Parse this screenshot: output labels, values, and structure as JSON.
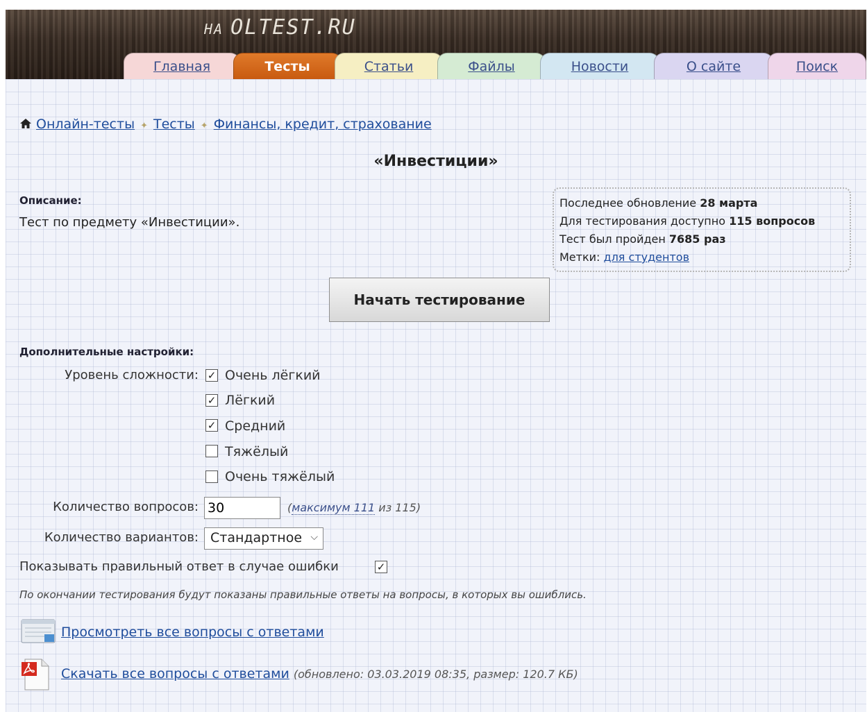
{
  "site": {
    "logo_prefix": "НА",
    "logo_text": "OLTEST.RU"
  },
  "nav": {
    "tabs": [
      {
        "label": "Главная",
        "active": false,
        "color": "#f6d7d7"
      },
      {
        "label": "Тесты",
        "active": true,
        "color": "#d9701e"
      },
      {
        "label": "Статьи",
        "active": false,
        "color": "#f6efc3"
      },
      {
        "label": "Файлы",
        "active": false,
        "color": "#d5ebd3"
      },
      {
        "label": "Новости",
        "active": false,
        "color": "#d3e7f2"
      },
      {
        "label": "О сайте",
        "active": false,
        "color": "#dad6f1"
      },
      {
        "label": "Поиск",
        "active": false,
        "color": "#efd6ea"
      }
    ]
  },
  "breadcrumb": {
    "home_icon": "home-icon",
    "items": [
      "Онлайн-тесты",
      "Тесты",
      "Финансы, кредит, страхование"
    ]
  },
  "test": {
    "title": "«Инвестиции»",
    "description_label": "Описание:",
    "description": "Тест по предмету «Инвестиции»."
  },
  "info": {
    "updated_label": "Последнее обновление",
    "updated_value": "28 марта",
    "available_label": "Для тестирования доступно",
    "available_value": "115 вопросов",
    "passed_label": "Тест был пройден",
    "passed_value": "7685 раз",
    "tags_label": "Метки:",
    "tag": "для студентов"
  },
  "start_button": "Начать тестирование",
  "settings": {
    "label": "Дополнительные настройки:",
    "difficulty_label": "Уровень сложности:",
    "difficulty": [
      {
        "label": "Очень лёгкий",
        "checked": true
      },
      {
        "label": "Лёгкий",
        "checked": true
      },
      {
        "label": "Средний",
        "checked": true
      },
      {
        "label": "Тяжёлый",
        "checked": false
      },
      {
        "label": "Очень тяжёлый",
        "checked": false
      }
    ],
    "questions_label": "Количество вопросов:",
    "questions_value": "30",
    "questions_hint_prefix": "(",
    "questions_hint_max": "максимум 111",
    "questions_hint_suffix": " из 115)",
    "variants_label": "Количество вариантов:",
    "variants_value": "Стандартное",
    "show_answer_label": "Показывать правильный ответ в случае ошибки",
    "show_answer_checked": true,
    "note": "По окончании тестирования будут показаны правильные ответы на вопросы, в которых вы ошиблись."
  },
  "resources": {
    "view_link": "Просмотреть все вопросы с ответами",
    "download_link": "Скачать все вопросы с ответами",
    "download_meta": "(обновлено: 03.03.2019 08:35, размер: 120.7 КБ)"
  },
  "colors": {
    "link": "#1f4d9c",
    "active_tab": "#d9701e"
  }
}
